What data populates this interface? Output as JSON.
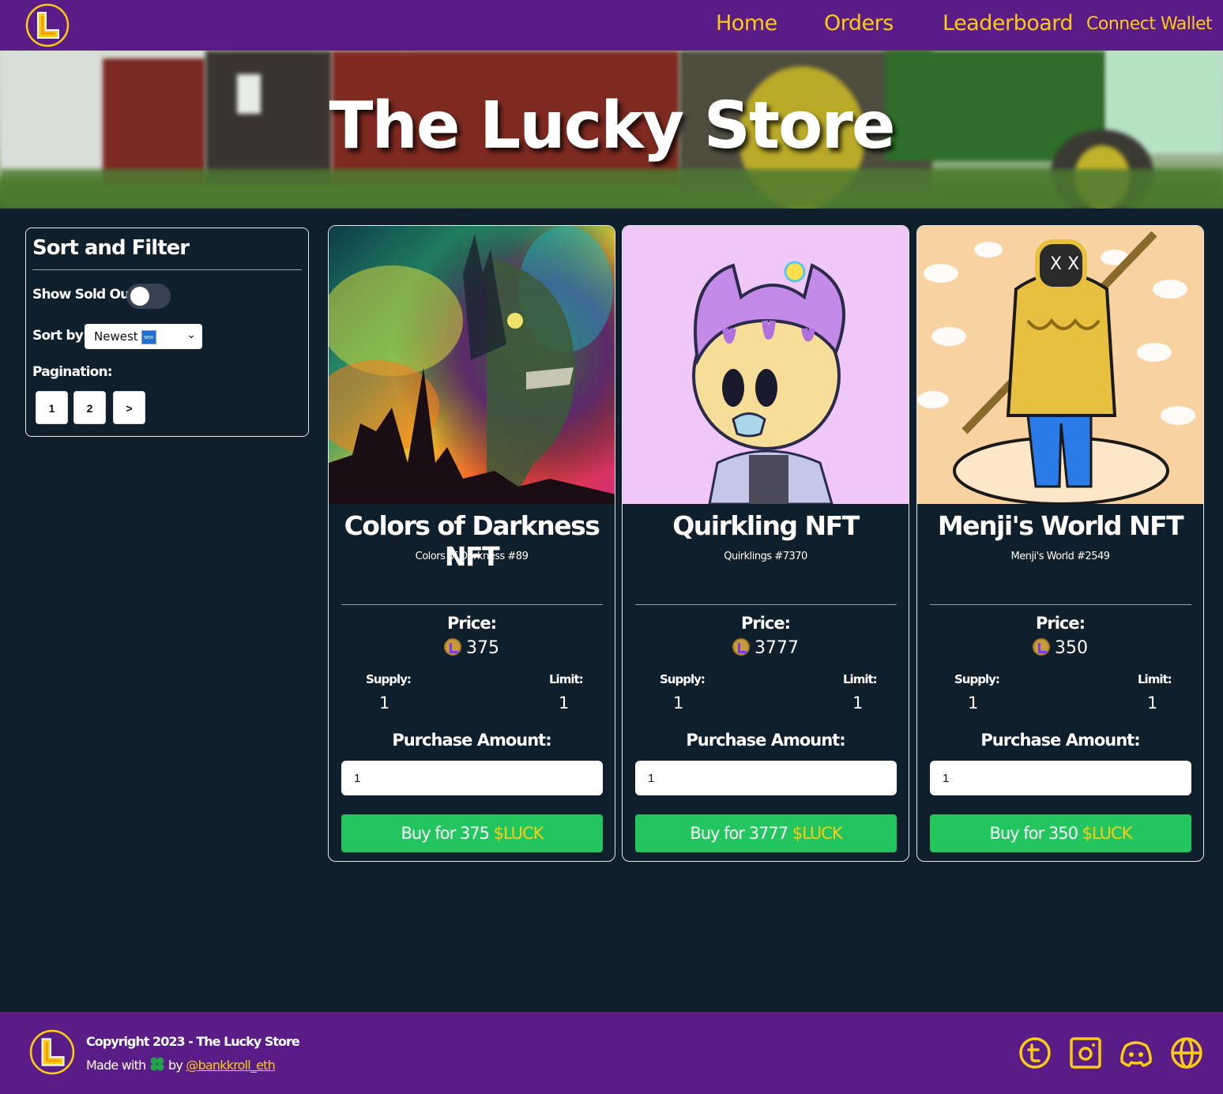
{
  "nav": {
    "links": [
      "Home",
      "Orders",
      "Leaderboard",
      "Connect Wallet"
    ]
  },
  "hero": {
    "title": "The Lucky Store"
  },
  "sidebar": {
    "title": "Sort and Filter",
    "show_sold_out_label": "Show Sold Out:",
    "show_sold_out": false,
    "sort_label": "Sort by:",
    "sort_value": "Newest",
    "sort_badge": "NEW",
    "pagination_label": "Pagination:",
    "pages": [
      "1",
      "2",
      ">"
    ]
  },
  "cards": [
    {
      "name": "Colors of Darkness NFT",
      "subtitle": "Colors of Darkness #89",
      "price_label": "Price:",
      "price": "375",
      "supply_label": "Supply:",
      "supply": "1",
      "limit_label": "Limit:",
      "limit": "1",
      "amount_label": "Purchase Amount:",
      "amount": "1",
      "buy_prefix": "Buy for 375",
      "buy_currency": "$LUCK"
    },
    {
      "name": "Quirkling NFT",
      "subtitle": "Quirklings #7370",
      "price_label": "Price:",
      "price": "3777",
      "supply_label": "Supply:",
      "supply": "1",
      "limit_label": "Limit:",
      "limit": "1",
      "amount_label": "Purchase Amount:",
      "amount": "1",
      "buy_prefix": "Buy for 3777",
      "buy_currency": "$LUCK"
    },
    {
      "name": "Menji's World NFT",
      "subtitle": "Menji's World #2549",
      "price_label": "Price:",
      "price": "350",
      "supply_label": "Supply:",
      "supply": "1",
      "limit_label": "Limit:",
      "limit": "1",
      "amount_label": "Purchase Amount:",
      "amount": "1",
      "buy_prefix": "Buy for 350",
      "buy_currency": "$LUCK"
    }
  ],
  "footer": {
    "copyright": "Copyright 2023 - The Lucky Store",
    "made_with": "Made with",
    "by": "by",
    "handle": "@bankkroll_eth",
    "social_icons": [
      "twitter-icon",
      "instagram-icon",
      "discord-icon",
      "website-icon"
    ]
  },
  "colors": {
    "nav_bg": "#5a1c87",
    "page_bg": "#0f1f2c",
    "accent": "#facc15",
    "buy_button": "#22c55e"
  }
}
